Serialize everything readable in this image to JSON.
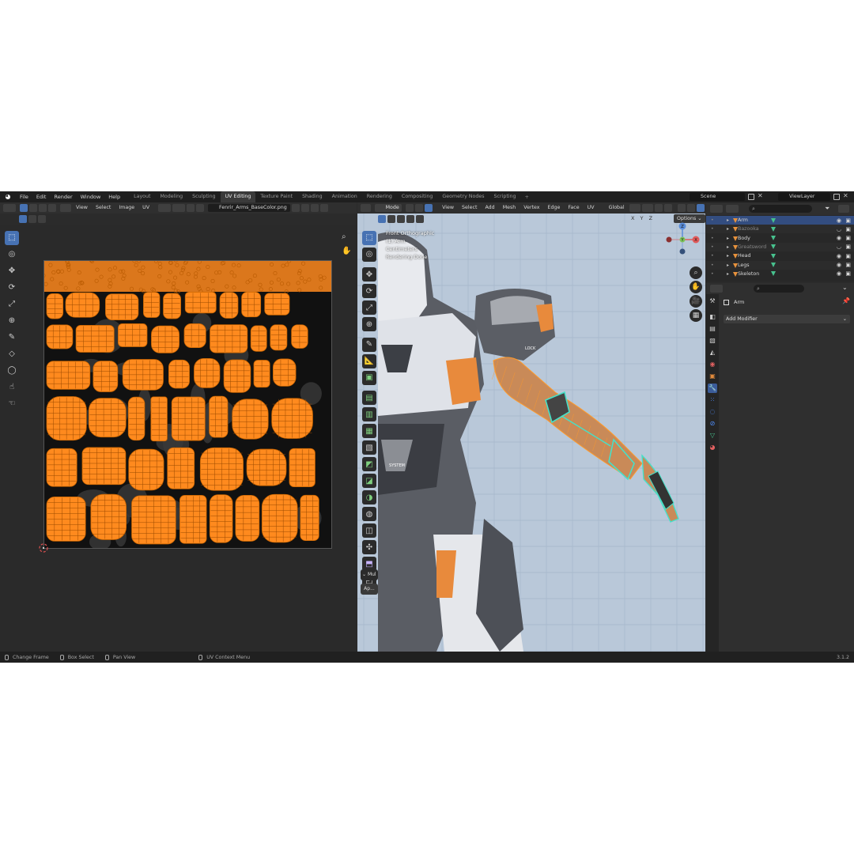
{
  "app": {
    "logo_icon": "blender-logo-icon",
    "menus": [
      "File",
      "Edit",
      "Render",
      "Window",
      "Help"
    ],
    "workspaces": [
      {
        "label": "Layout",
        "active": false
      },
      {
        "label": "Modeling",
        "active": false
      },
      {
        "label": "Sculpting",
        "active": false
      },
      {
        "label": "UV Editing",
        "active": true
      },
      {
        "label": "Texture Paint",
        "active": false
      },
      {
        "label": "Shading",
        "active": false
      },
      {
        "label": "Animation",
        "active": false
      },
      {
        "label": "Rendering",
        "active": false
      },
      {
        "label": "Compositing",
        "active": false
      },
      {
        "label": "Geometry Nodes",
        "active": false
      },
      {
        "label": "Scripting",
        "active": false
      }
    ],
    "add_workspace": "+",
    "scene": "Scene",
    "view_layer": "ViewLayer",
    "version": "3.1.2",
    "accent_color": "#4772b3",
    "uv_color": "#ff8a1e"
  },
  "uv_editor": {
    "menus": [
      "View",
      "Select",
      "Image",
      "UV"
    ],
    "image_name": "Fenrir_Arms_BaseColor.png"
  },
  "viewport": {
    "mode": "Mode",
    "menus": [
      "View",
      "Select",
      "Add",
      "Mesh",
      "Vertex",
      "Edge",
      "Face",
      "UV"
    ],
    "transform": "Global",
    "axes": [
      "X",
      "Y",
      "Z"
    ],
    "options": "Options",
    "overlay_lines": [
      "Front Orthographic",
      "(1) Arm",
      "Centimeters",
      "Rendering Done"
    ],
    "gizmo": {
      "x": "X",
      "y": "Y",
      "z": "Z"
    },
    "last_op": "Mul",
    "apply_btn": "Ap...",
    "armor_text": "LOCK",
    "armor_text2": "SYSTEM"
  },
  "outliner": {
    "items": [
      {
        "name": "Arm",
        "selected": true,
        "dim": false
      },
      {
        "name": "Bazooka",
        "selected": false,
        "dim": true
      },
      {
        "name": "Body",
        "selected": false,
        "dim": false
      },
      {
        "name": "Greatsword",
        "selected": false,
        "dim": true
      },
      {
        "name": "Head",
        "selected": false,
        "dim": false
      },
      {
        "name": "Legs",
        "selected": false,
        "dim": false
      },
      {
        "name": "Skeleton",
        "selected": false,
        "dim": false
      }
    ]
  },
  "properties": {
    "object_name": "Arm",
    "add_modifier": "Add Modifier"
  },
  "statusbar": {
    "items": [
      "Change Frame",
      "Box Select",
      "Pan View",
      "UV Context Menu"
    ]
  }
}
